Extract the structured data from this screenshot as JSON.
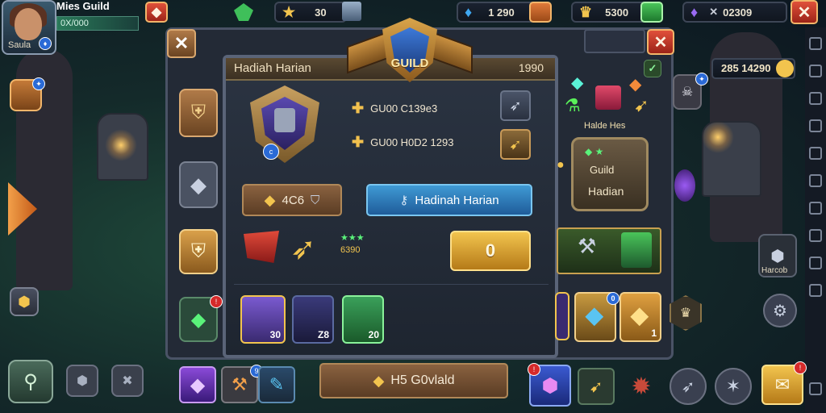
{
  "player": {
    "name": "Mies Guild",
    "level_text": "0X/000",
    "avatar_label": "Saula"
  },
  "resources": [
    {
      "icon": "star-icon",
      "value": "30"
    },
    {
      "icon": "blue-diamond-icon",
      "value": "1 290"
    },
    {
      "icon": "gold-crown-icon",
      "value": "5300"
    },
    {
      "icon": "purple-gem-icon",
      "value": "02309"
    }
  ],
  "panel": {
    "title": "Hadiah Harian",
    "header_number": "1990",
    "crest_label": "GUILD",
    "bonus_lines": [
      "GU00 C139e3",
      "GU00 H0D2 1293"
    ],
    "currency_value": "4C6",
    "claim_button": "Hadinah Harian",
    "reward_counts": "6390",
    "gold_button": "0",
    "item_counts": [
      "30",
      "Z8",
      "20"
    ],
    "bottom_button": "H5 G0vlald"
  },
  "right_panel": {
    "gold_value": "285 14290",
    "daily_label": "Halde Hes",
    "badge_title": "Guild",
    "badge_subtitle": "Hadian",
    "item_counts": [
      "0",
      "1"
    ],
    "mini_label": "Harcob"
  },
  "colors": {
    "gold": "#f2c44e",
    "blue_button": "#3f9ad4",
    "red_button": "#c73a28",
    "panel": "#2b3442"
  }
}
